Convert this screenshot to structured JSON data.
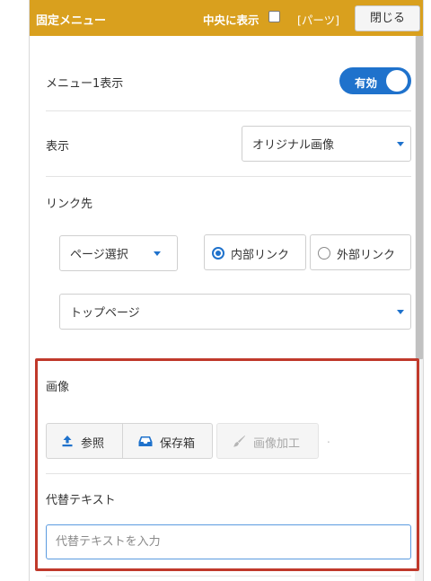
{
  "header": {
    "title": "固定メニュー",
    "center_label": "中央に表示",
    "parts_label": "[パーツ]",
    "close_label": "閉じる"
  },
  "menu_display": {
    "label": "メニュー1表示",
    "toggle_text": "有効",
    "enabled": true
  },
  "display": {
    "label": "表示",
    "selected": "オリジナル画像"
  },
  "link": {
    "label": "リンク先",
    "page_select": "ページ選択",
    "internal_label": "内部リンク",
    "external_label": "外部リンク",
    "selected_option": "内部リンク",
    "target_page": "トップページ"
  },
  "image": {
    "label": "画像",
    "browse_label": "参照",
    "storage_label": "保存箱",
    "edit_label": "画像加工",
    "trailing_mark": "."
  },
  "alt_text": {
    "label": "代替テキスト",
    "placeholder": "代替テキストを入力",
    "value": ""
  },
  "colors": {
    "header_bg": "#d9a01e",
    "accent": "#1f72cc",
    "highlight_border": "#c0392b"
  }
}
